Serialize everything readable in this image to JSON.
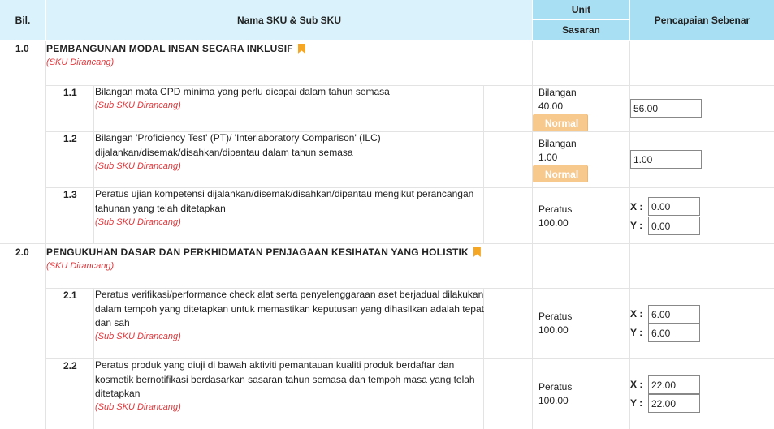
{
  "header": {
    "bil": "Bil.",
    "nama": "Nama SKU & Sub SKU",
    "unit": "Unit",
    "sasaran": "Sasaran",
    "pencapaian": "Pencapaian Sebenar"
  },
  "sections": [
    {
      "num": "1.0",
      "title": "PEMBANGUNAN MODAL INSAN SECARA INKLUSIF",
      "status": "(SKU Dirancang)",
      "items": [
        {
          "num": "1.1",
          "desc": "Bilangan mata CPD minima yang perlu dicapai dalam tahun semasa",
          "status": "(Sub SKU Dirancang)",
          "unit": "Bilangan",
          "target": "40.00",
          "badge": "Normal",
          "value": "56.00"
        },
        {
          "num": "1.2",
          "desc": "Bilangan 'Proficiency Test' (PT)/ 'Interlaboratory Comparison' (ILC) dijalankan/disemak/disahkan/dipantau dalam tahun semasa",
          "status": "(Sub SKU Dirancang)",
          "unit": "Bilangan",
          "target": "1.00",
          "badge": "Normal",
          "value": "1.00"
        },
        {
          "num": "1.3",
          "desc": "Peratus ujian kompetensi dijalankan/disemak/disahkan/dipantau mengikut perancangan tahunan yang telah ditetapkan",
          "status": "(Sub SKU Dirancang)",
          "unit": "Peratus",
          "target": "100.00",
          "x": "0.00",
          "y": "0.00"
        }
      ]
    },
    {
      "num": "2.0",
      "title": "PENGUKUHAN DASAR DAN PERKHIDMATAN PENJAGAAN KESIHATAN YANG HOLISTIK",
      "status": "(SKU Dirancang)",
      "items": [
        {
          "num": "2.1",
          "desc": "Peratus verifikasi/performance check alat serta penyelenggaraan aset berjadual dilakukan dalam tempoh yang ditetapkan untuk memastikan keputusan yang dihasilkan adalah tepat dan sah",
          "status": "(Sub SKU Dirancang)",
          "unit": "Peratus",
          "target": "100.00",
          "x": "6.00",
          "y": "6.00"
        },
        {
          "num": "2.2",
          "desc": "Peratus produk yang diuji di bawah aktiviti pemantauan kualiti produk berdaftar dan kosmetik bernotifikasi berdasarkan sasaran tahun semasa dan tempoh masa yang telah ditetapkan",
          "status": "(Sub SKU Dirancang)",
          "unit": "Peratus",
          "target": "100.00",
          "x": "22.00",
          "y": "22.00"
        }
      ]
    }
  ],
  "labels": {
    "x": "X :",
    "y": "Y :"
  },
  "colors": {
    "header_light": "#d9f2fb",
    "header_dark": "#a9dff2",
    "status_red": "#e0373b",
    "badge": "#f7c98d",
    "bookmark": "#f5a623"
  }
}
